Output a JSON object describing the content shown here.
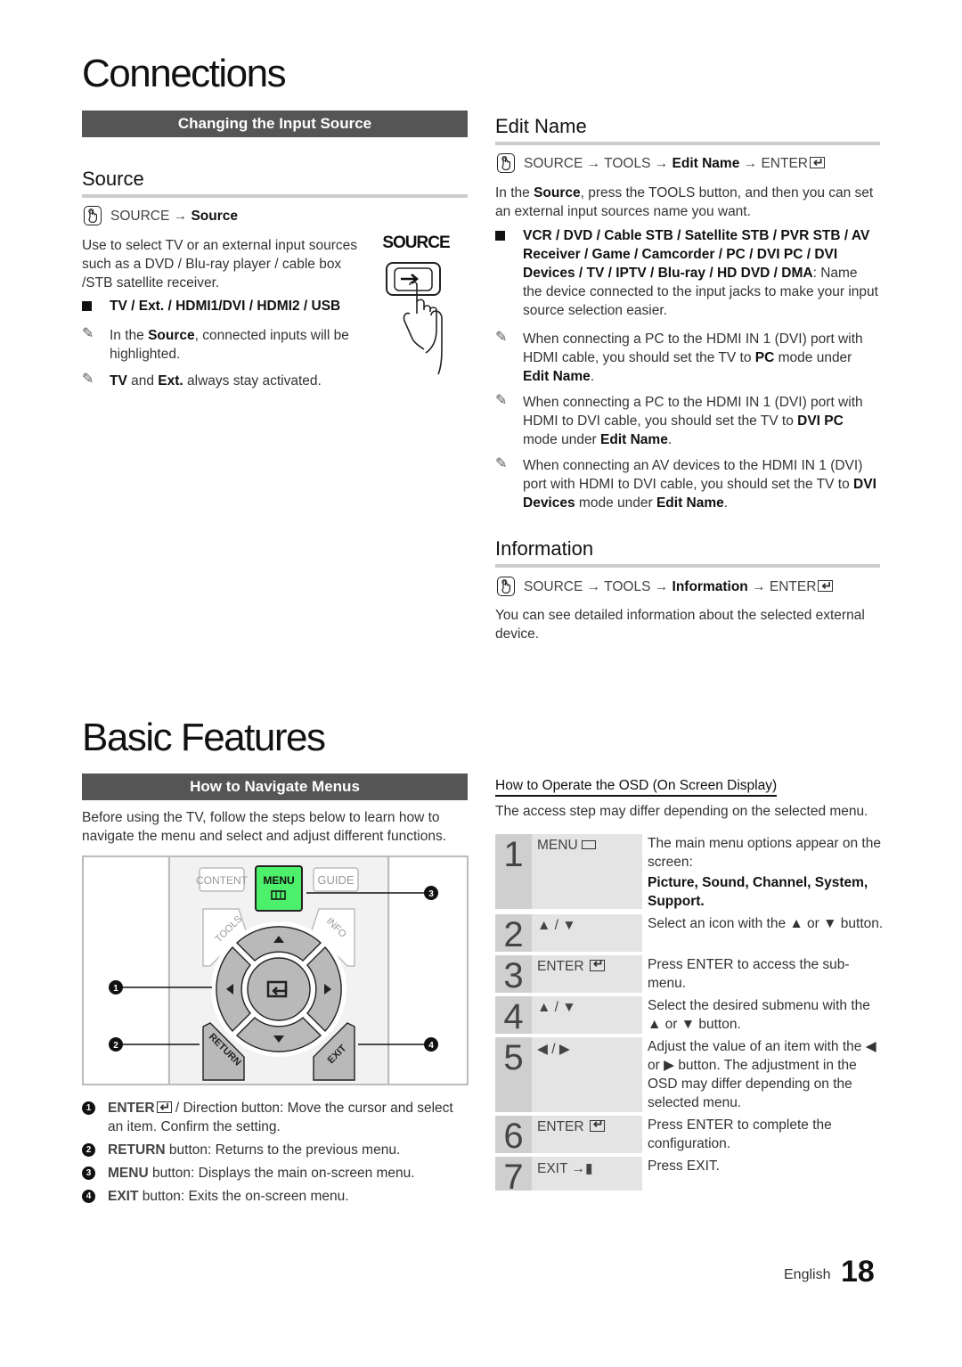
{
  "connections": {
    "chapter_title": "Connections",
    "bar_heading": "Changing the Input Source",
    "source": {
      "title": "Source",
      "path_prefix": "SOURCE →",
      "path_target": "Source",
      "description": "Use to select TV or an external input sources such as a DVD / Blu-ray player / cable box /STB satellite receiver.",
      "bullet": "TV / Ext. / HDMI1/DVI / HDMI2 / USB",
      "notes": [
        {
          "pre": "In the ",
          "bold": "Source",
          "post": ", connected inputs will be highlighted."
        },
        {
          "bold1": "TV",
          "mid": " and ",
          "bold2": "Ext.",
          "post": " always stay activated."
        }
      ],
      "button_label": "SOURCE"
    },
    "edit_name": {
      "title": "Edit Name",
      "path": [
        "SOURCE → TOOLS →",
        "Edit Name",
        "→ ENTER"
      ],
      "intro_pre": "In the ",
      "intro_bold": "Source",
      "intro_post": ", press the TOOLS button, and then you can set an external input sources name you want.",
      "bullet_bold": "VCR / DVD / Cable STB / Satellite STB / PVR STB / AV Receiver / Game / Camcorder / PC / DVI PC / DVI Devices / TV / IPTV / Blu-ray / HD DVD / DMA",
      "bullet_post": ": Name the device connected to the input jacks to make your input source selection easier.",
      "notes": [
        {
          "a": "When connecting a PC to the HDMI IN 1 (DVI) port with HDMI cable, you should set the TV to ",
          "b": "PC",
          "c": " mode under ",
          "d": "Edit Name",
          "e": "."
        },
        {
          "a": "When connecting a PC to the HDMI IN 1 (DVI) port with HDMI to DVI cable, you should set the TV to ",
          "b": "DVI PC",
          "c": " mode under ",
          "d": "Edit Name",
          "e": "."
        },
        {
          "a": "When connecting an AV devices to the HDMI IN 1 (DVI) port with HDMI to DVI cable, you should set the TV to ",
          "b": "DVI Devices",
          "c": " mode under ",
          "d": "Edit Name",
          "e": "."
        }
      ]
    },
    "information": {
      "title": "Information",
      "path": [
        "SOURCE → TOOLS →",
        "Information",
        "→ ENTER"
      ],
      "description": "You can see detailed information about the selected external device."
    }
  },
  "basic_features": {
    "chapter_title": "Basic Features",
    "bar_heading": "How to Navigate Menus",
    "intro": "Before using the TV, follow the steps below to learn how to navigate the menu and select and adjust different functions.",
    "remote": {
      "content": "CONTENT",
      "menu": "MENU",
      "guide": "GUIDE",
      "tools": "TOOLS",
      "info": "INFO",
      "return": "RETURN",
      "exit": "EXIT",
      "menu_color": "#4cf06a",
      "callouts": [
        "1",
        "2",
        "3",
        "4"
      ]
    },
    "legend": [
      {
        "num": "1",
        "bold": "ENTER",
        "text": " / Direction button: Move the cursor and select an item. Confirm the setting."
      },
      {
        "num": "2",
        "bold": "RETURN",
        "text": " button: Returns to the previous menu."
      },
      {
        "num": "3",
        "bold": "MENU",
        "text": " button: Displays the main on-screen menu."
      },
      {
        "num": "4",
        "bold": "EXIT",
        "text": " button: Exits the on-screen menu."
      }
    ],
    "osd": {
      "title": "How to Operate the OSD (On Screen Display)",
      "subtitle": "The access step may differ depending on the selected menu.",
      "steps": [
        {
          "num": "1",
          "key": "MENU",
          "desc": "The main menu options appear on the screen:",
          "extra": "Picture, Sound, Channel, System, Support."
        },
        {
          "num": "2",
          "key": "▲ / ▼",
          "desc": "Select an icon with the ▲ or ▼ button."
        },
        {
          "num": "3",
          "key": "ENTER",
          "desc": "Press ENTER to access the sub-menu."
        },
        {
          "num": "4",
          "key": "▲ / ▼",
          "desc": "Select the desired submenu with the ▲ or ▼ button."
        },
        {
          "num": "5",
          "key": "◀ / ▶",
          "desc": "Adjust the value of an item with the ◀ or ▶ button. The adjustment in the OSD may differ depending on the selected menu."
        },
        {
          "num": "6",
          "key": "ENTER",
          "desc": "Press ENTER to complete the configuration."
        },
        {
          "num": "7",
          "key": "EXIT",
          "desc": "Press EXIT."
        }
      ]
    }
  },
  "footer": {
    "language": "English",
    "page_number": "18"
  }
}
